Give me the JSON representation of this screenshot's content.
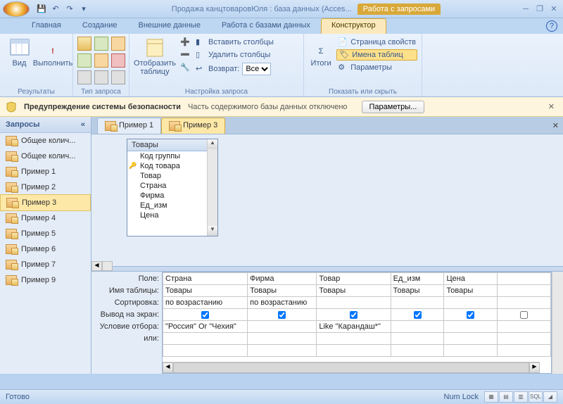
{
  "title": {
    "app": "Продажа канцтоваровЮля : база данных (Acces...",
    "context": "Работа с запросами"
  },
  "tabs": {
    "home": "Главная",
    "create": "Создание",
    "external": "Внешние данные",
    "dbtools": "Работа с базами данных",
    "designer": "Конструктор"
  },
  "ribbon": {
    "results": {
      "label": "Результаты",
      "view": "Вид",
      "run": "Выполнить"
    },
    "qtype": {
      "label": "Тип запроса"
    },
    "setup": {
      "label": "Настройка запроса",
      "showtable": "Отобразить таблицу",
      "inscol": "Вставить столбцы",
      "delcol": "Удалить столбцы",
      "return": "Возврат:",
      "return_val": "Все"
    },
    "showhide": {
      "label": "Показать или скрыть",
      "totals": "Итоги",
      "propsheet": "Страница свойств",
      "tablenames": "Имена таблиц",
      "params": "Параметры"
    }
  },
  "security": {
    "title": "Предупреждение системы безопасности",
    "msg": "Часть содержимого базы данных отключено",
    "btn": "Параметры..."
  },
  "nav": {
    "header": "Запросы",
    "items": [
      "Общее колич...",
      "Общее колич...",
      "Пример 1",
      "Пример 2",
      "Пример 3",
      "Пример 4",
      "Пример 5",
      "Пример 6",
      "Пример 7",
      "Пример 9"
    ],
    "selected": 4
  },
  "doctabs": {
    "t1": "Пример 1",
    "t2": "Пример 3"
  },
  "tablebox": {
    "title": "Товары",
    "fields": [
      "Код группы",
      "Код товара",
      "Товар",
      "Страна",
      "Фирма",
      "Ед_изм",
      "Цена"
    ],
    "key_index": 1
  },
  "gridlabels": {
    "field": "Поле:",
    "table": "Имя таблицы:",
    "sort": "Сортировка:",
    "show": "Вывод на экран:",
    "criteria": "Условие отбора:",
    "or": "или:"
  },
  "grid": {
    "cols": [
      {
        "field": "Страна",
        "table": "Товары",
        "sort": "по возрастанию",
        "show": true,
        "criteria": "\"Россия\" Or \"Чехия\""
      },
      {
        "field": "Фирма",
        "table": "Товары",
        "sort": "по возрастанию",
        "show": true,
        "criteria": ""
      },
      {
        "field": "Товар",
        "table": "Товары",
        "sort": "",
        "show": true,
        "criteria": "Like \"Карандаш*\""
      },
      {
        "field": "Ед_изм",
        "table": "Товары",
        "sort": "",
        "show": true,
        "criteria": ""
      },
      {
        "field": "Цена",
        "table": "Товары",
        "sort": "",
        "show": true,
        "criteria": ""
      },
      {
        "field": "",
        "table": "",
        "sort": "",
        "show": false,
        "criteria": ""
      }
    ]
  },
  "status": {
    "ready": "Готово",
    "numlock": "Num Lock",
    "sql": "SQL"
  }
}
